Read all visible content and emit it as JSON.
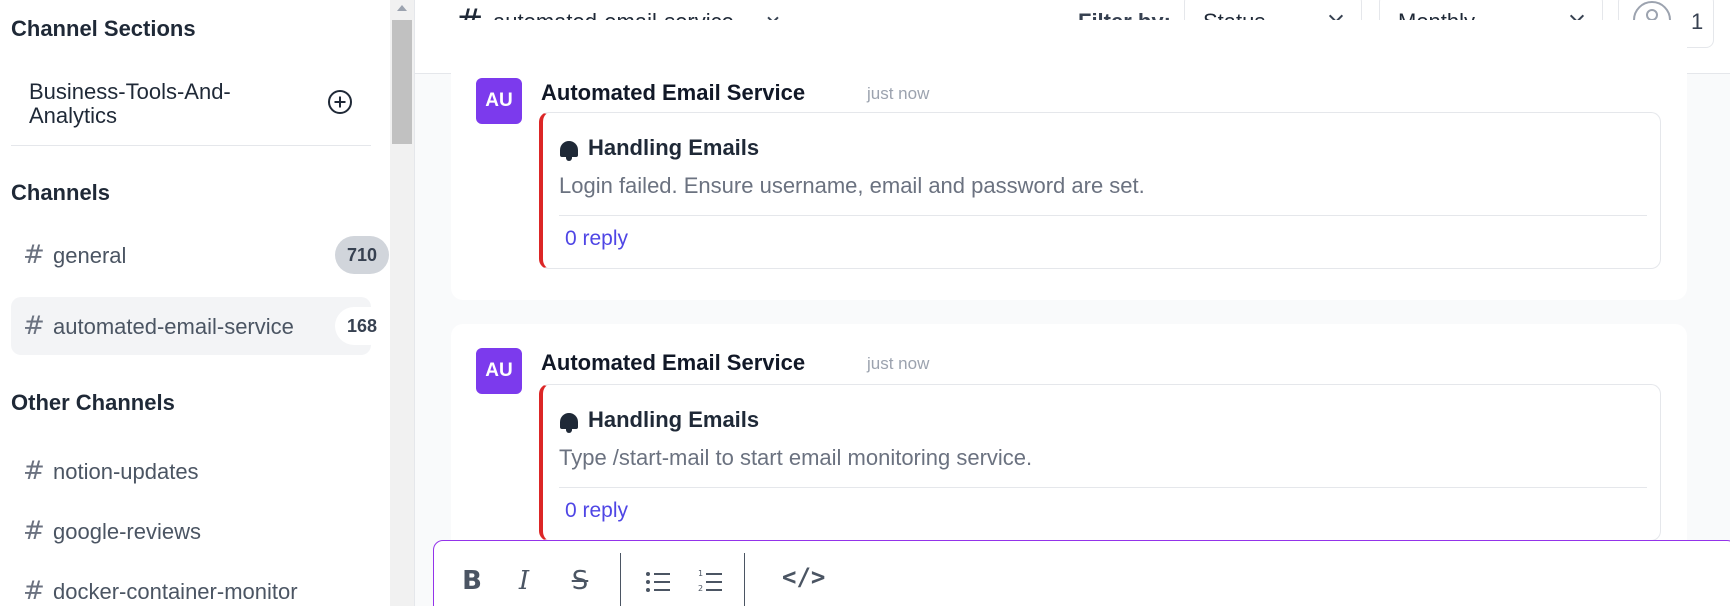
{
  "sidebar": {
    "channel_sections_heading": "Channel Sections",
    "section": {
      "name": "Business-Tools-And-Analytics"
    },
    "channels_heading": "Channels",
    "channels": [
      {
        "name": "general",
        "count": "710"
      },
      {
        "name": "automated-email-service",
        "count": "168"
      }
    ],
    "other_channels_heading": "Other Channels",
    "other_channels": [
      {
        "name": "notion-updates"
      },
      {
        "name": "google-reviews"
      },
      {
        "name": "docker-container-monitor"
      }
    ]
  },
  "header": {
    "hash": "#",
    "channel_name": "automated-email-service",
    "filter_label": "Filter by:",
    "status_select": "Status",
    "period_select": "Monthly",
    "user_count": "1"
  },
  "messages": [
    {
      "avatar": "AU",
      "author": "Automated Email Service",
      "time": "just now",
      "title": "Handling Emails",
      "text": "Login failed. Ensure username, email and password are set.",
      "reply": "0 reply"
    },
    {
      "avatar": "AU",
      "author": "Automated Email Service",
      "time": "just now",
      "title": "Handling Emails",
      "text": "Type /start-mail to start email monitoring service.",
      "reply": "0 reply"
    }
  ],
  "composer": {
    "bold": "B",
    "italic": "I",
    "strike": "S",
    "code": "</>"
  },
  "colors": {
    "accent": "#4f46e5",
    "avatar": "#7c3aed",
    "alert_border": "#dc2626",
    "composer_border": "#9333ea"
  }
}
